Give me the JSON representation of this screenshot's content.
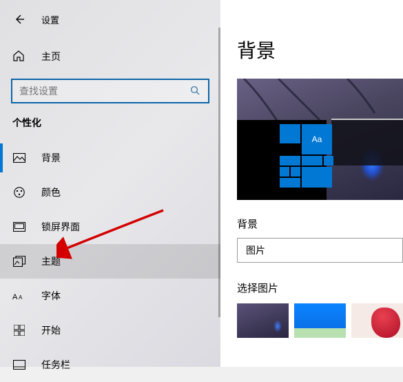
{
  "header": {
    "back_label": "设置"
  },
  "home": {
    "label": "主页"
  },
  "search": {
    "placeholder": "查找设置"
  },
  "category": "个性化",
  "nav": [
    {
      "key": "background",
      "label": "背景"
    },
    {
      "key": "colors",
      "label": "颜色"
    },
    {
      "key": "lockscreen",
      "label": "锁屏界面"
    },
    {
      "key": "themes",
      "label": "主题"
    },
    {
      "key": "fonts",
      "label": "字体"
    },
    {
      "key": "start",
      "label": "开始"
    },
    {
      "key": "taskbar",
      "label": "任务栏"
    }
  ],
  "page": {
    "title": "背景",
    "preview_aa": "Aa",
    "bg_field_label": "背景",
    "bg_dropdown_value": "图片",
    "choose_label": "选择图片"
  },
  "colors": {
    "accent": "#0078d4",
    "search_border": "#0a64a8"
  }
}
